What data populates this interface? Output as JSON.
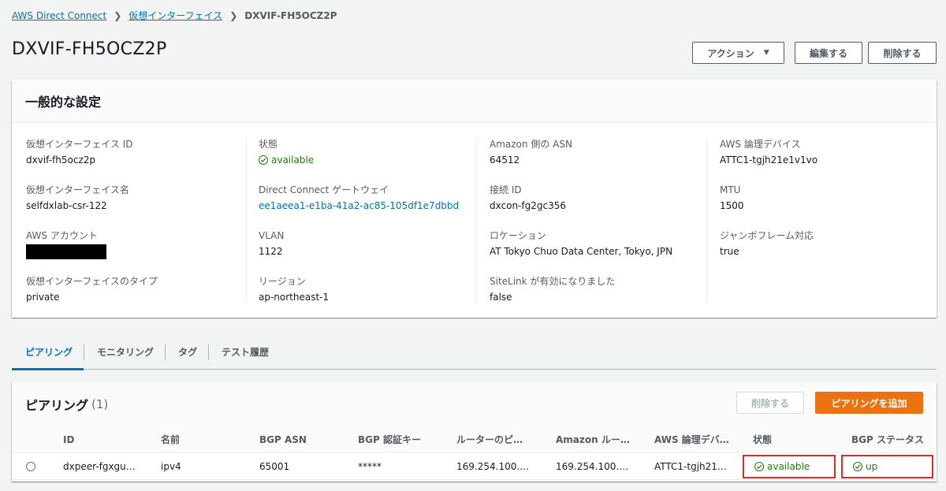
{
  "breadcrumb": {
    "items": [
      "AWS Direct Connect",
      "仮想インターフェイス"
    ],
    "current": "DXVIF-FH5OCZ2P"
  },
  "page_title": "DXVIF-FH5OCZ2P",
  "header_buttons": {
    "actions": "アクション",
    "edit": "編集する",
    "delete": "削除する"
  },
  "general": {
    "title": "一般的な設定",
    "fields": {
      "vif_id": {
        "label": "仮想インターフェイス ID",
        "value": "dxvif-fh5ocz2p"
      },
      "vif_name": {
        "label": "仮想インターフェイス名",
        "value": "selfdxlab-csr-122"
      },
      "aws_account": {
        "label": "AWS アカウント",
        "value": ""
      },
      "vif_type": {
        "label": "仮想インターフェイスのタイプ",
        "value": "private"
      },
      "state": {
        "label": "状態",
        "value": "available"
      },
      "dxgw": {
        "label": "Direct Connect ゲートウェイ",
        "value": "ee1aeea1-e1ba-41a2-ac85-105df1e7dbbd"
      },
      "vlan": {
        "label": "VLAN",
        "value": "1122"
      },
      "region": {
        "label": "リージョン",
        "value": "ap-northeast-1"
      },
      "amazon_asn": {
        "label": "Amazon 側の ASN",
        "value": "64512"
      },
      "connection_id": {
        "label": "接続 ID",
        "value": "dxcon-fg2gc356"
      },
      "location": {
        "label": "ロケーション",
        "value": "AT Tokyo Chuo Data Center, Tokyo, JPN"
      },
      "sitelink": {
        "label": "SiteLink が有効になりました",
        "value": "false"
      },
      "logical_device": {
        "label": "AWS 論理デバイス",
        "value": "ATTC1-tgjh21e1v1vo"
      },
      "mtu": {
        "label": "MTU",
        "value": "1500"
      },
      "jumbo": {
        "label": "ジャンボフレーム対応",
        "value": "true"
      }
    }
  },
  "tabs": [
    "ピアリング",
    "モニタリング",
    "タグ",
    "テスト履歴"
  ],
  "peering": {
    "title": "ピアリング",
    "count": "(1)",
    "delete_label": "削除する",
    "add_label": "ピアリングを追加",
    "columns": [
      "ID",
      "名前",
      "BGP ASN",
      "BGP 認証キー",
      "ルーターのピ…",
      "Amazon ルー…",
      "AWS 論理デバ…",
      "状態",
      "BGP ステータス"
    ],
    "rows": [
      [
        "dxpeer-fgxgu…",
        "ipv4",
        "65001",
        "*****",
        "169.254.100.…",
        "169.254.100.…",
        "ATTC1-tgjh21…",
        "available",
        "up"
      ]
    ]
  },
  "colors": {
    "link": "#0073bb",
    "success": "#1d8102",
    "primary_button": "#ec7211",
    "highlight": "#e02c23"
  }
}
